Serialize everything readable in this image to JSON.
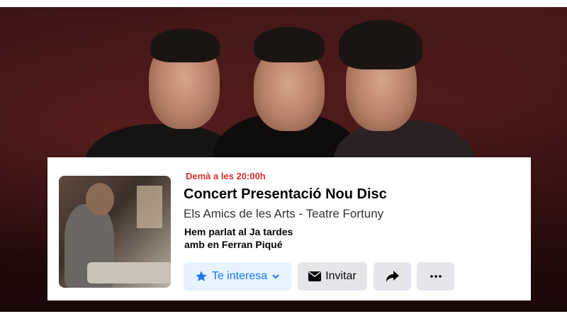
{
  "event": {
    "date_label": "Demà a les 20:00h",
    "title": "Concert Presentació Nou Disc",
    "subtitle": "Els Amics de les Arts - Teatre Fortuny",
    "description_lines": [
      "Hem parlat al Ja tardes",
      "amb en Ferran Piqué"
    ]
  },
  "actions": {
    "interest_label": "Te interesa",
    "interest_icon": "star-icon",
    "interest_dropdown_icon": "chevron-down-icon",
    "invite_label": "Invitar",
    "invite_icon": "envelope-icon",
    "share_icon": "share-arrow-icon",
    "more_icon": "ellipsis-icon"
  },
  "colors": {
    "date": "#d0312d",
    "accent": "#1877f2",
    "accent_bg": "#e7f3ff",
    "button_bg": "#e4e6eb"
  }
}
